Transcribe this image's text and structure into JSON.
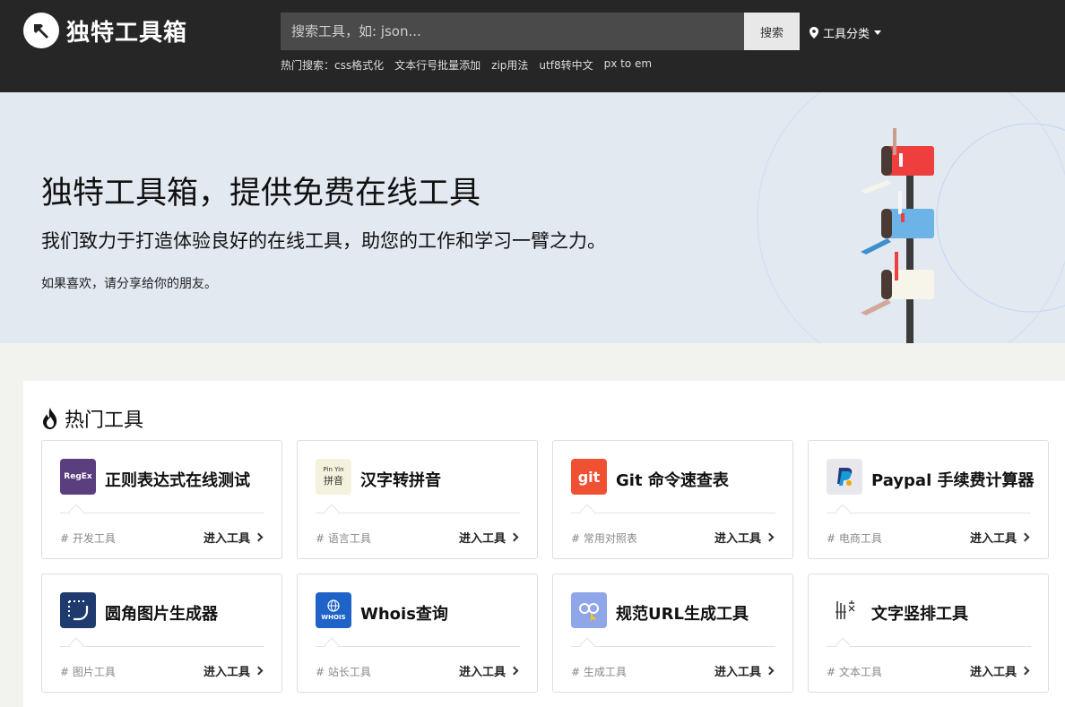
{
  "header": {
    "logo_text": "独特工具箱",
    "search_placeholder": "搜索工具，如: json...",
    "search_button": "搜索",
    "category_label": "工具分类",
    "hot_search_label": "热门搜索：",
    "hot_search_items": [
      "css格式化",
      "文本行号批量添加",
      "zip用法",
      "utf8转中文",
      "px to em"
    ]
  },
  "hero": {
    "title": "独特工具箱，提供免费在线工具",
    "subtitle": "我们致力于打造体验良好的在线工具，助您的工作和学习一臂之力。",
    "note": "如果喜欢，请分享给你的朋友。"
  },
  "section": {
    "title": "热门工具"
  },
  "cards": [
    {
      "name": "正则表达式在线测试",
      "tag": "# 开发工具",
      "enter": "进入工具",
      "icon": "regex-icon",
      "icon_text": "RegEx",
      "color": "#5a3e7e"
    },
    {
      "name": "汉字转拼音",
      "tag": "# 语言工具",
      "enter": "进入工具",
      "icon": "pinyin-icon",
      "icon_text": "Pin Yin",
      "icon_text2": "拼音",
      "color": "#f4f1dc"
    },
    {
      "name": "Git 命令速查表",
      "tag": "# 常用对照表",
      "enter": "进入工具",
      "icon": "git-icon",
      "icon_text": "git",
      "color": "#f05133"
    },
    {
      "name": "Paypal 手续费计算器",
      "tag": "# 电商工具",
      "enter": "进入工具",
      "icon": "paypal-icon",
      "color": "#e8e8ec"
    },
    {
      "name": "圆角图片生成器",
      "tag": "# 图片工具",
      "enter": "进入工具",
      "icon": "rounded-corner-icon",
      "color": "#1f3a6e"
    },
    {
      "name": "Whois查询",
      "tag": "# 站长工具",
      "enter": "进入工具",
      "icon": "whois-icon",
      "icon_text": "WHOIS",
      "color": "#1f63c9"
    },
    {
      "name": "规范URL生成工具",
      "tag": "# 生成工具",
      "enter": "进入工具",
      "icon": "url-link-icon",
      "color": "#8fa6e8"
    },
    {
      "name": "文字竖排工具",
      "tag": "# 文本工具",
      "enter": "进入工具",
      "icon": "vertical-text-icon",
      "color": "#ffffff"
    }
  ]
}
